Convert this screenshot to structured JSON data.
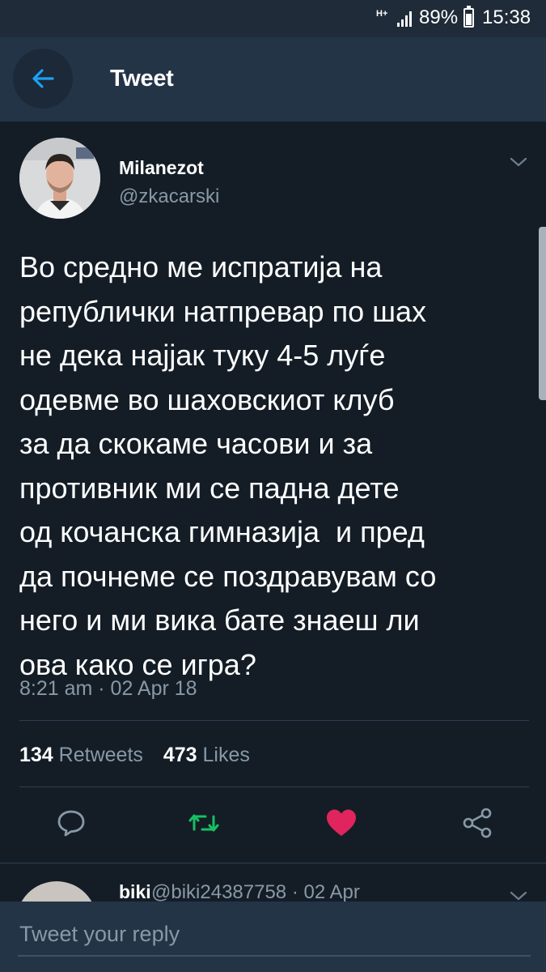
{
  "status_bar": {
    "network": "H+",
    "battery_percent": "89%",
    "time": "15:38",
    "icons": [
      "network-type-icon",
      "signal-icon",
      "battery-icon"
    ]
  },
  "header": {
    "title": "Tweet",
    "back_icon": "arrow-left-icon"
  },
  "tweet": {
    "author_name": "Milanezot",
    "author_handle": "@zkacarski",
    "text": "Во средно ме испратија на\nрепублички натпревар по шах\nне дека најјак туку 4-5 луѓе\nодевме во шаховскиот клуб\nза да скокаме часови и за\nпротивник ми се падна дете\nод кочанска гимназија  и пред\nда почнеме се поздравувам со\nнего и ми вика бате знаеш ли\nова како се игра?",
    "timestamp": "8:21 am · 02 Apr 18",
    "retweets_count": "134",
    "retweets_label": "Retweets",
    "likes_count": "473",
    "likes_label": "Likes",
    "actions": [
      "reply-icon",
      "retweet-icon",
      "like-icon",
      "share-icon"
    ]
  },
  "reply_preview": {
    "name": "biki",
    "meta": "@biki24387758 · 02 Apr"
  },
  "reply_bar": {
    "placeholder": "Tweet your reply"
  },
  "colors": {
    "background": "#141d26",
    "header": "#243447",
    "accent_blue": "#1da1f2",
    "retweet_green": "#17bf63",
    "like_red": "#e0245e",
    "secondary_text": "#8899a6"
  }
}
